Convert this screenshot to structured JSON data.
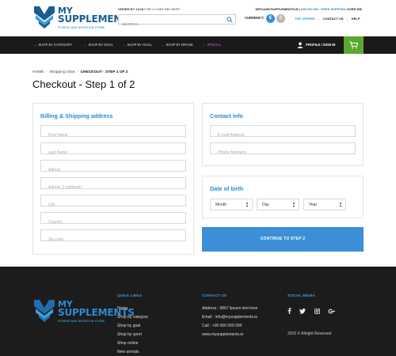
{
  "header": {
    "logo_line1": "MY",
    "logo_line2": "SUPPLEMENTS",
    "logo_tagline": "FITNESS AND NUTRITION STORE",
    "order_note_bold": "ORDER BY 12/18",
    "order_note_rest": "FOR 1-3 DAY DELIVERY",
    "search_placeholder": "SEARCH...",
    "info_email": "INFO@MYSUPPLEMENTS.IE",
    "info_phone": "000 000 000",
    "info_shipping": "FREE SHIPPING",
    "info_shipping_rest": "OVER 50€",
    "currency_label": "CURRENCY:",
    "currency_eur": "€",
    "currency_gbp": "£",
    "top_links": [
      "TOP OFFERS",
      "CONTACT US",
      "HELP"
    ],
    "colors": {
      "brand": "#1a5d8f",
      "accent": "#2a8ad6",
      "cart": "#5ba82e"
    }
  },
  "nav": {
    "items": [
      "SHOP BY CATEGORY",
      "SHOP BY GOAL",
      "SHOP BY GOAL",
      "SHOP BY BRAND",
      "SPECIAL"
    ],
    "signin": "PROFILE / SIGN IN",
    "cart_icon": "cart-icon"
  },
  "breadcrumb": {
    "home": "HOME",
    "cart": "Shopping chart",
    "current": "CHECKOUT - STEP 1 OF 2"
  },
  "page_title": "Checkout - Step 1 of 2",
  "billing": {
    "title": "Billing & Shipping address",
    "fields": [
      "First Name",
      "Last Name",
      "Adress",
      "Adress 2 (optional)",
      "City",
      "Country",
      "Zip code"
    ]
  },
  "contact": {
    "title": "Contact info",
    "fields": [
      "E-mail Address",
      "Phone Numbers"
    ]
  },
  "dob": {
    "title": "Date of birth",
    "month": "Month",
    "day": "Day",
    "year": "Year"
  },
  "continue_label": "CONTINUE TO STEP 2",
  "footer": {
    "quick_links_title": "QUICK LINKS",
    "quick_links": [
      "Home",
      "Shop by category",
      "Shop by goal",
      "Shop by sport",
      "Shop online",
      "New arrivals"
    ],
    "contact_title": "CONTACT US",
    "contact_lines": [
      "Address : 9867 lipsum text here",
      "Email : info@mysupplements.ie",
      "Call : +00 000 000 000",
      "www.mysupplements.ie"
    ],
    "social_title": "SOCIAL MEDIA",
    "social_icons": [
      "facebook-icon",
      "twitter-icon",
      "instagram-icon",
      "google-plus-icon"
    ],
    "copyright": "2015 © Allright Reserved"
  }
}
